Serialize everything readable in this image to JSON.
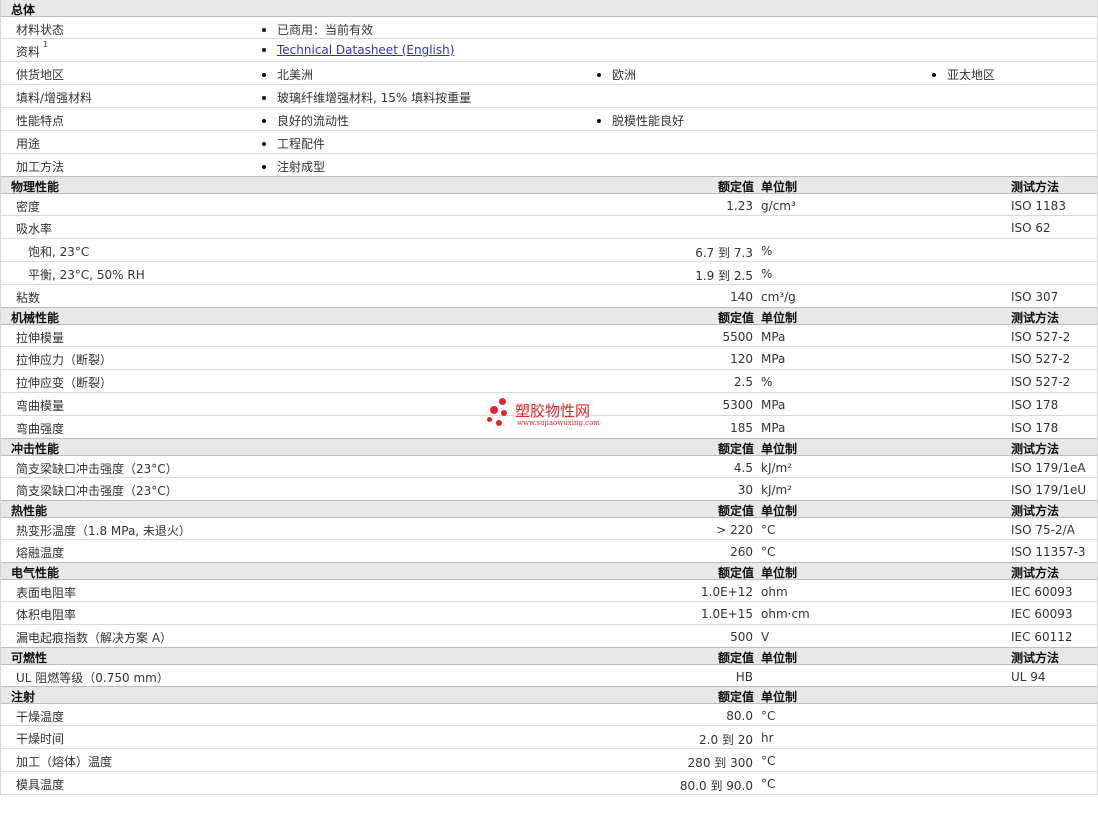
{
  "general": {
    "title": "总体",
    "rows": [
      {
        "label": "材料状态",
        "items": [
          "已商用：当前有效"
        ]
      },
      {
        "label": "资料",
        "sup": "1",
        "items": [],
        "link": "Technical Datasheet (English)"
      },
      {
        "label": "供货地区",
        "items": [
          "北美洲",
          "欧洲",
          "亚太地区"
        ]
      },
      {
        "label": "填料/增强材料",
        "items": [
          "玻璃纤维增强材料, 15% 填料按重量"
        ]
      },
      {
        "label": "性能特点",
        "items": [
          "良好的流动性",
          "脱模性能良好"
        ]
      },
      {
        "label": "用途",
        "items": [
          "工程配件"
        ]
      },
      {
        "label": "加工方法",
        "items": [
          "注射成型"
        ]
      }
    ]
  },
  "headers": {
    "value": "额定值",
    "unit": "单位制",
    "method": "测试方法"
  },
  "sections": [
    {
      "title": "物理性能",
      "show_method": true,
      "rows": [
        {
          "label": "密度",
          "value": "1.23",
          "unit": "g/cm³",
          "method": "ISO 1183"
        },
        {
          "label": "吸水率",
          "value": "",
          "unit": "",
          "method": "ISO 62"
        },
        {
          "label": "饱和, 23°C",
          "sub": true,
          "value": "6.7 到  7.3",
          "unit": "%",
          "method": ""
        },
        {
          "label": "平衡, 23°C, 50% RH",
          "sub": true,
          "value": "1.9 到  2.5",
          "unit": "%",
          "method": ""
        },
        {
          "label": "粘数",
          "value": "140",
          "unit": "cm³/g",
          "method": "ISO 307"
        }
      ]
    },
    {
      "title": "机械性能",
      "show_method": true,
      "rows": [
        {
          "label": "拉伸模量",
          "value": "5500",
          "unit": "MPa",
          "method": "ISO 527-2"
        },
        {
          "label": "拉伸应力（断裂）",
          "value": "120",
          "unit": "MPa",
          "method": "ISO 527-2"
        },
        {
          "label": "拉伸应变（断裂）",
          "value": "2.5",
          "unit": "%",
          "method": "ISO 527-2"
        },
        {
          "label": "弯曲模量",
          "value": "5300",
          "unit": "MPa",
          "method": "ISO 178"
        },
        {
          "label": "弯曲强度",
          "value": "185",
          "unit": "MPa",
          "method": "ISO 178"
        }
      ]
    },
    {
      "title": "冲击性能",
      "show_method": true,
      "rows": [
        {
          "label": "简支梁缺口冲击强度（23°C）",
          "value": "4.5",
          "unit": "kJ/m²",
          "method": "ISO 179/1eA"
        },
        {
          "label": "简支梁缺口冲击强度（23°C）",
          "value": "30",
          "unit": "kJ/m²",
          "method": "ISO 179/1eU"
        }
      ]
    },
    {
      "title": "热性能",
      "show_method": true,
      "rows": [
        {
          "label": "热变形温度（1.8 MPa, 未退火）",
          "value": "> 220",
          "unit": "°C",
          "method": "ISO 75-2/A"
        },
        {
          "label": "熔融温度",
          "value": "260",
          "unit": "°C",
          "method": "ISO 11357-3"
        }
      ]
    },
    {
      "title": "电气性能",
      "show_method": true,
      "rows": [
        {
          "label": "表面电阻率",
          "value": "1.0E+12",
          "unit": "ohm",
          "method": "IEC 60093"
        },
        {
          "label": "体积电阻率",
          "value": "1.0E+15",
          "unit": "ohm·cm",
          "method": "IEC 60093"
        },
        {
          "label": "漏电起痕指数（解决方案 A）",
          "value": "500",
          "unit": "V",
          "method": "IEC 60112"
        }
      ]
    },
    {
      "title": "可燃性",
      "show_method": true,
      "rows": [
        {
          "label": "UL 阻燃等级（0.750 mm）",
          "value": "HB",
          "unit": "",
          "method": "UL 94"
        }
      ]
    },
    {
      "title": "注射",
      "show_method": false,
      "rows": [
        {
          "label": "干燥温度",
          "value": "80.0",
          "unit": "°C",
          "method": ""
        },
        {
          "label": "干燥时间",
          "value": "2.0 到  20",
          "unit": "hr",
          "method": ""
        },
        {
          "label": "加工（熔体）温度",
          "value": "280 到  300",
          "unit": "°C",
          "method": ""
        },
        {
          "label": "模具温度",
          "value": "80.0 到  90.0",
          "unit": "°C",
          "method": ""
        }
      ]
    }
  ],
  "watermark": {
    "name": "塑胶物性网",
    "url": "www.sujiaowuxing.com",
    "color": "#e3242b"
  }
}
